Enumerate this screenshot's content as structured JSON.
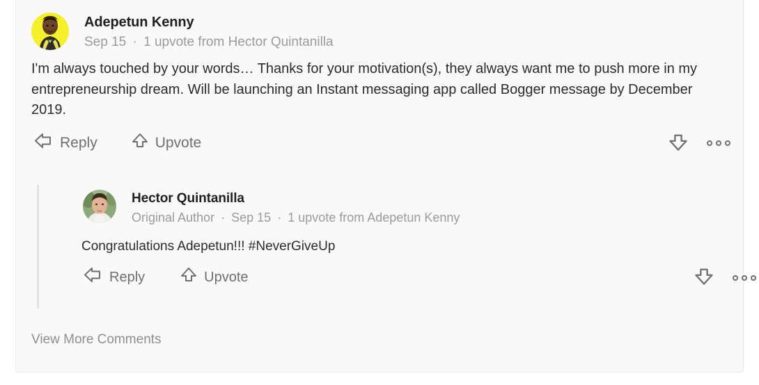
{
  "theme": {
    "card_bg": "#f9f9f9",
    "page_bg": "#ffffff",
    "name_color": "#1f1f1f",
    "meta_color": "#9b9b9b",
    "body_color": "#2b2b2b",
    "action_color": "#6f6f6f",
    "thread_line_color": "#e3e3e3",
    "avatar1_bg": "#f5f02a"
  },
  "top_comment": {
    "author": "Adepetun Kenny",
    "avatar_name": "adepetun-kenny-avatar",
    "meta": {
      "date": "Sep 15",
      "separator": "·",
      "upvotes": "1 upvote from Hector Quintanilla"
    },
    "body": "I'm always touched by your words… Thanks for your motivation(s), they always want me to push more in my entrepreneurship dream. Will be launching an Instant messaging app called Bogger message by December 2019.",
    "actions": {
      "reply_label": "Reply",
      "upvote_label": "Upvote",
      "reply_icon": "reply-arrow-icon",
      "upvote_icon": "upvote-arrow-icon",
      "downvote_icon": "downvote-arrow-icon",
      "more_icon": "more-options-icon"
    }
  },
  "nested_comment": {
    "author": "Hector Quintanilla",
    "avatar_name": "hector-quintanilla-avatar",
    "meta": {
      "badge": "Original Author",
      "separator1": "·",
      "date": "Sep 15",
      "separator2": "·",
      "upvotes": "1 upvote from Adepetun Kenny"
    },
    "body": "Congratulations Adepetun!!! #NeverGiveUp",
    "actions": {
      "reply_label": "Reply",
      "upvote_label": "Upvote",
      "reply_icon": "reply-arrow-icon",
      "upvote_icon": "upvote-arrow-icon",
      "downvote_icon": "downvote-arrow-icon",
      "more_icon": "more-options-icon"
    }
  },
  "footer": {
    "view_more_label": "View More Comments"
  }
}
